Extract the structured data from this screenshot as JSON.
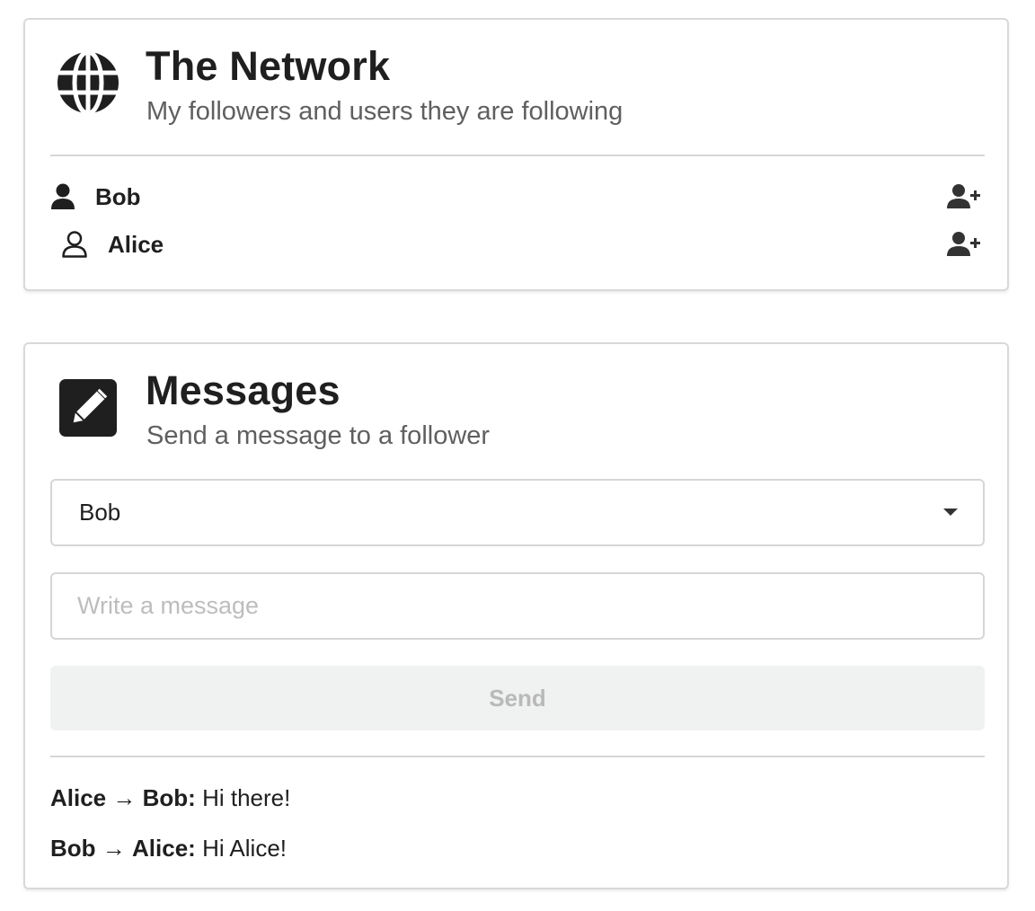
{
  "network": {
    "title": "The Network",
    "subtitle": "My followers and users they are following",
    "header_icon": "globe-icon",
    "users": [
      {
        "name": "Bob",
        "icon": "user-solid-icon",
        "action_icon": "user-plus-icon"
      },
      {
        "name": "Alice",
        "icon": "user-outline-icon",
        "action_icon": "user-plus-icon"
      }
    ]
  },
  "messages": {
    "title": "Messages",
    "subtitle": "Send a message to a follower",
    "header_icon": "pencil-square-icon",
    "recipient_selected": "Bob",
    "input_placeholder": "Write a message",
    "input_value": "",
    "send_label": "Send",
    "log": [
      {
        "from": "Alice",
        "arrow": "→",
        "to": "Bob",
        "text": "Hi there!"
      },
      {
        "from": "Bob",
        "arrow": "→",
        "to": "Alice",
        "text": "Hi Alice!"
      }
    ]
  },
  "colors": {
    "text": "#1f1f1f",
    "subtext": "#5f5f5f",
    "border": "#d6d6d6",
    "button_bg": "#f0f1f1",
    "button_text": "#b9b9b9",
    "placeholder": "#bdbdbd"
  }
}
